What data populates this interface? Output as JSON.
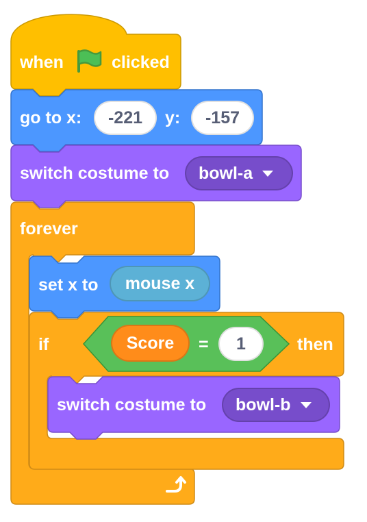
{
  "colors": {
    "events": "#ffbf00",
    "motion": "#4c97ff",
    "looks": "#9966ff",
    "control": "#ffab19",
    "operators": "#59c059",
    "variables": "#ff8c1a",
    "sensing_reporter": "#5cb1d6",
    "flag": "#4cbf56"
  },
  "script": {
    "hat": {
      "when": "when",
      "flag_icon": "green-flag-icon",
      "clicked": "clicked"
    },
    "goto": {
      "label": "go to x:",
      "x": "-221",
      "y_label": "y:",
      "y": "-157"
    },
    "switch1": {
      "label": "switch costume to",
      "costume": "bowl-a"
    },
    "forever": {
      "label": "forever",
      "loop_icon": "loop-arrow-icon"
    },
    "setx": {
      "label": "set x to",
      "reporter": "mouse x"
    },
    "if": {
      "if_label": "if",
      "then_label": "then",
      "condition": {
        "variable": "Score",
        "operator": "=",
        "value": "1"
      }
    },
    "switch2": {
      "label": "switch costume to",
      "costume": "bowl-b"
    }
  }
}
